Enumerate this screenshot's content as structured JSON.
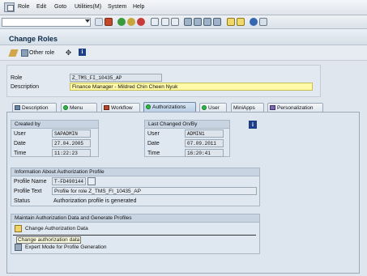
{
  "menu": [
    "Role",
    "Edit",
    "Goto",
    "Utilities(M)",
    "System",
    "Help"
  ],
  "window": {
    "title": "Change Roles"
  },
  "app_toolbar": {
    "other_role": "Other role"
  },
  "role": {
    "role_label": "Role",
    "role_value": "Z_TMS_FI_10435_AP",
    "description_label": "Description",
    "description_value": "Finance Manager - Mildred Chin Cheen Nyuk"
  },
  "tabs": [
    {
      "label": "Description"
    },
    {
      "label": "Menu"
    },
    {
      "label": "Workflow"
    },
    {
      "label": "Authorizations"
    },
    {
      "label": "User"
    },
    {
      "label": "MiniApps"
    },
    {
      "label": "Personalization"
    }
  ],
  "created_by": {
    "title": "Created by",
    "user_label": "User",
    "user_value": "SAPADMIN",
    "date_label": "Date",
    "date_value": "27.04.2005",
    "time_label": "Time",
    "time_value": "11:22:23"
  },
  "last_changed": {
    "title": "Last Changed On/By",
    "user_label": "User",
    "user_value": "ADMIN1",
    "date_label": "Date",
    "date_value": "07.09.2011",
    "time_label": "Time",
    "time_value": "16:20:41"
  },
  "auth_profile": {
    "title": "Information About Authorization Profile",
    "profile_name_label": "Profile Name",
    "profile_name_value": "T-FD490144",
    "profile_text_label": "Profile Text",
    "profile_text_value": "Profile for role Z_TMS_FI_10435_AP",
    "status_label": "Status",
    "status_value": "Authorization profile is generated"
  },
  "maintain": {
    "title": "Maintain Authorization Data and Generate Profiles",
    "change_auth": "Change Authorization Data",
    "tooltip": "Change authorization data",
    "expert_mode": "Expert Mode for Profile Generation"
  },
  "colors": {
    "accent": "#0d2a48",
    "tab_active": "#bcd0e6",
    "highlight_field": "#fff9a8",
    "status_ok": "#2db847"
  }
}
